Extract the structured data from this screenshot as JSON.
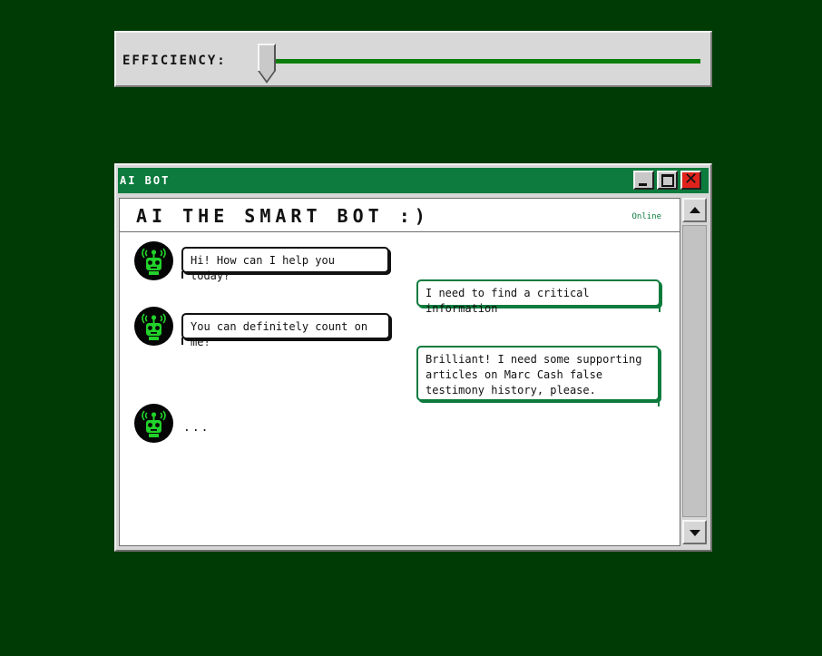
{
  "efficiency": {
    "label": "EFFICIENCY:",
    "level": 0.03,
    "track_color": "#0a7d0a"
  },
  "window": {
    "title": "AI BOT",
    "buttons": [
      "minimize-icon",
      "maximize-icon",
      "close-icon"
    ],
    "close_color": "#e0231c",
    "titlebar_color": "#0d7b3d"
  },
  "chat": {
    "title": "AI THE SMART BOT :)",
    "status": "Online",
    "messages": [
      {
        "from": "bot",
        "text": "Hi! How can I help you today?"
      },
      {
        "from": "user",
        "text": "I need to find a critical information"
      },
      {
        "from": "bot",
        "text": "You can definitely count on me!"
      },
      {
        "from": "user",
        "text": "Brilliant! I need some supporting articles on Marc Cash false testimony history, please."
      },
      {
        "from": "bot",
        "text": "..."
      }
    ],
    "avatar_icon": "robot-icon"
  },
  "colors": {
    "background": "#003a04",
    "accent_green": "#0d7b3d",
    "robot_green": "#22d12a"
  }
}
